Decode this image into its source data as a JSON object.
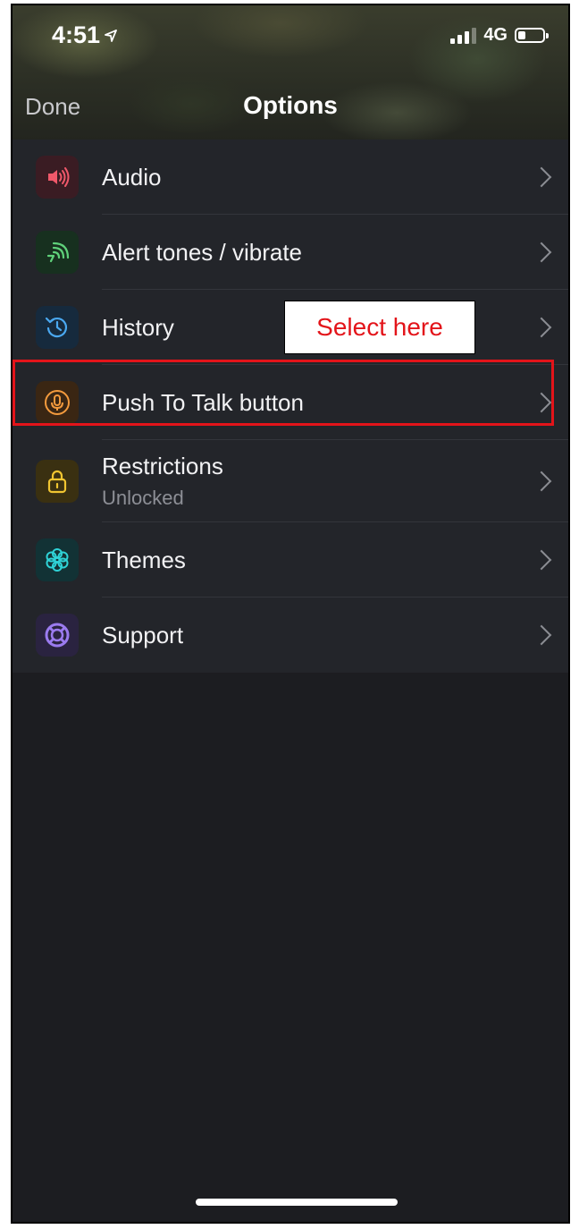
{
  "status": {
    "time": "4:51",
    "network": "4G"
  },
  "nav": {
    "done_label": "Done",
    "title": "Options"
  },
  "items": [
    {
      "label": "Audio",
      "icon": "speaker-icon",
      "icon_color": "#f0586a",
      "icon_bg": "#3a1c23"
    },
    {
      "label": "Alert tones / vibrate",
      "icon": "alert-waves-icon",
      "icon_color": "#5fd17a",
      "icon_bg": "#17301f"
    },
    {
      "label": "History",
      "icon": "history-icon",
      "icon_color": "#4aa8f0",
      "icon_bg": "#162a3d"
    },
    {
      "label": "Push To Talk button",
      "icon": "microphone-icon",
      "icon_color": "#f39a3d",
      "icon_bg": "#3a2613"
    },
    {
      "label": "Restrictions",
      "sublabel": "Unlocked",
      "icon": "lock-icon",
      "icon_color": "#f0c531",
      "icon_bg": "#3a3011"
    },
    {
      "label": "Themes",
      "icon": "flower-icon",
      "icon_color": "#2fd2d6",
      "icon_bg": "#123235"
    },
    {
      "label": "Support",
      "icon": "lifebuoy-icon",
      "icon_color": "#9b7bef",
      "icon_bg": "#2a2340"
    }
  ],
  "annotation": {
    "text": "Select here",
    "color": "#e3141a"
  }
}
